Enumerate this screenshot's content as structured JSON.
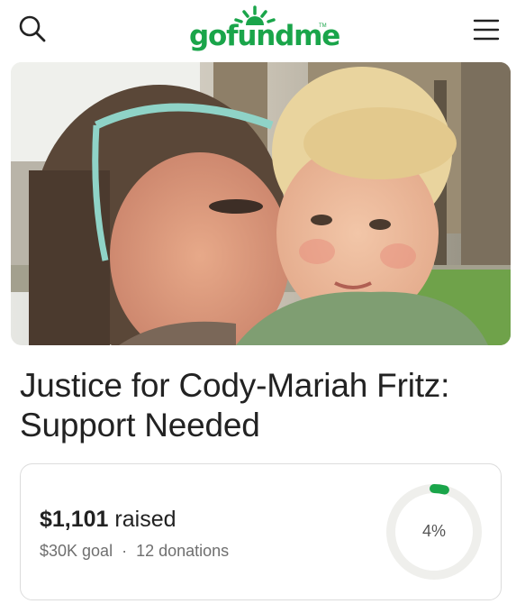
{
  "header": {
    "logo_text": "gofundme",
    "logo_tm": "TM",
    "icons": {
      "search": "search-icon",
      "menu": "hamburger-menu-icon"
    }
  },
  "colors": {
    "brand_green": "#1aa54a",
    "ring_track": "#efefec",
    "text": "#222222",
    "muted": "#6f6f6f"
  },
  "campaign": {
    "title_line1": "Justice for Cody-Mariah Fritz:",
    "title_line2": "Support Needed",
    "raised_amount": "$1,101",
    "raised_suffix": "raised",
    "goal_text": "$30K goal",
    "separator": "·",
    "donations_text": "12 donations",
    "progress_label": "4%",
    "progress_fraction": 0.04
  }
}
